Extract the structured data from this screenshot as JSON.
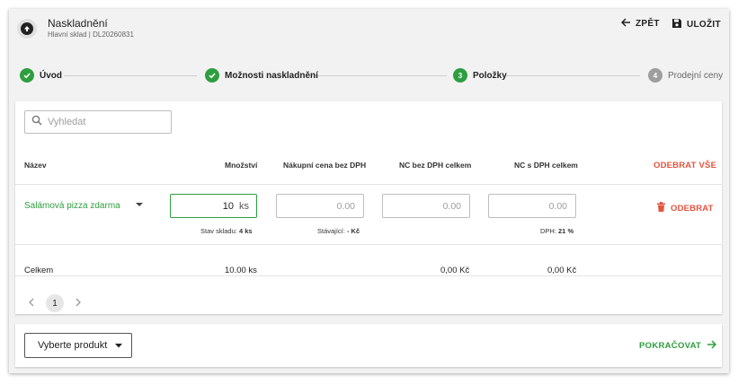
{
  "header": {
    "title": "Naskladnění",
    "subtitle": "Hlavní sklad | DL20260831",
    "back_label": "ZPĚT",
    "save_label": "ULOŽIT"
  },
  "stepper": {
    "steps": [
      {
        "number": "",
        "label": "Úvod",
        "state": "done"
      },
      {
        "number": "",
        "label": "Možnosti naskladnění",
        "state": "done"
      },
      {
        "number": "3",
        "label": "Položky",
        "state": "active"
      },
      {
        "number": "4",
        "label": "Prodejní ceny",
        "state": "pending"
      }
    ]
  },
  "search": {
    "placeholder": "Vyhledat",
    "value": ""
  },
  "table": {
    "columns": [
      "Název",
      "Množství",
      "Nákupní cena bez DPH",
      "NC bez DPH celkem",
      "NC s DPH celkem"
    ],
    "remove_all_label": "ODEBRAT VŠE",
    "rows": [
      {
        "name": "Salámová pizza zdarma",
        "quantity": "10",
        "unit": "ks",
        "purchase_price": "0.00",
        "nc_without_vat_total": "0.00",
        "nc_with_vat_total": "0.00",
        "stock_hint_label": "Stav skladu:",
        "stock_hint_value": "4 ks",
        "existing_hint_label": "Stávající:",
        "existing_hint_value": "- Kč",
        "vat_hint_label": "DPH:",
        "vat_hint_value": "21 %",
        "remove_label": "ODEBRAT"
      }
    ],
    "totals": {
      "label": "Celkem",
      "quantity": "10.00 ks",
      "nc_without_vat": "0,00 Kč",
      "nc_with_vat": "0,00 Kč"
    }
  },
  "pagination": {
    "current_page": "1"
  },
  "footer": {
    "select_product_label": "Vyberte produkt",
    "continue_label": "POKRAČOVAT"
  },
  "colors": {
    "accent": "#2e9e3f",
    "danger": "#e5533d",
    "pending": "#9e9e9e"
  },
  "icons": [
    "arrow-up-icon",
    "arrow-left-icon",
    "save-icon",
    "check-icon",
    "search-icon",
    "caret-down-icon",
    "trash-icon",
    "chevron-left-icon",
    "chevron-right-icon",
    "arrow-right-icon"
  ]
}
